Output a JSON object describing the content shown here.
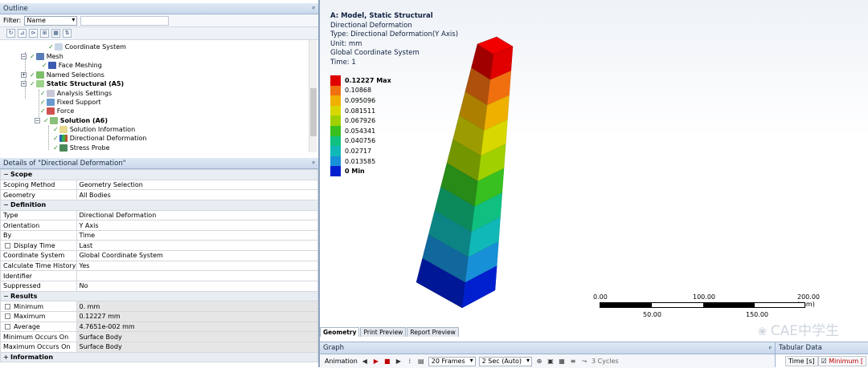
{
  "outline": {
    "title": "Outline",
    "pin": "ᵖ",
    "filter_label": "Filter:",
    "filter_value": "Name",
    "toolbar_icons": [
      "refresh-icon",
      "expand-icon",
      "flag-icon",
      "collapse-all-icon",
      "image-icon",
      "sort-icon"
    ],
    "tree": [
      {
        "label": "Coordinate System",
        "bold": false
      },
      {
        "label": "Mesh",
        "bold": false
      },
      {
        "label": "Face Meshing",
        "bold": false
      },
      {
        "label": "Named Selections",
        "bold": false
      },
      {
        "label": "Static Structural (A5)",
        "bold": true
      },
      {
        "label": "Analysis Settings",
        "bold": false
      },
      {
        "label": "Fixed Support",
        "bold": false
      },
      {
        "label": "Force",
        "bold": false
      },
      {
        "label": "Solution (A6)",
        "bold": true
      },
      {
        "label": "Solution Information",
        "bold": false
      },
      {
        "label": "Directional Deformation",
        "bold": false
      },
      {
        "label": "Stress Probe",
        "bold": false
      }
    ]
  },
  "details": {
    "title": "Details of \"Directional Deformation\"",
    "sections": [
      {
        "name": "Scope",
        "rows": [
          {
            "k": "Scoping Method",
            "v": "Geometry Selection"
          },
          {
            "k": "Geometry",
            "v": "All Bodies"
          }
        ]
      },
      {
        "name": "Definition",
        "rows": [
          {
            "k": "Type",
            "v": "Directional Deformation"
          },
          {
            "k": "Orientation",
            "v": "Y Axis"
          },
          {
            "k": "By",
            "v": "Time"
          },
          {
            "k": "Display Time",
            "v": "Last"
          },
          {
            "k": "Coordinate System",
            "v": "Global Coordinate System"
          },
          {
            "k": "Calculate Time History",
            "v": "Yes"
          },
          {
            "k": "Identifier",
            "v": ""
          },
          {
            "k": "Suppressed",
            "v": "No"
          }
        ]
      },
      {
        "name": "Results",
        "rows": [
          {
            "k": "Minimum",
            "v": "0. mm"
          },
          {
            "k": "Maximum",
            "v": "0.12227 mm"
          },
          {
            "k": "Average",
            "v": "4.7651e-002 mm"
          },
          {
            "k": "Minimum Occurs On",
            "v": "Surface Body"
          },
          {
            "k": "Maximum Occurs On",
            "v": "Surface Body"
          }
        ]
      },
      {
        "name": "Information",
        "rows": []
      }
    ]
  },
  "viewport": {
    "info": {
      "title": "A: Model, Static Structural",
      "line1": "Directional Deformation",
      "line2": "Type: Directional Deformation(Y Axis)",
      "line3": "Unit: mm",
      "line4": "Global Coordinate System",
      "line5": "Time: 1"
    },
    "legend": [
      {
        "label": "0.12227 Max",
        "color": "#e00000",
        "bold": true
      },
      {
        "label": "0.10868",
        "color": "#f07010",
        "bold": false
      },
      {
        "label": "0.095096",
        "color": "#f0b000",
        "bold": false
      },
      {
        "label": "0.081511",
        "color": "#d8d800",
        "bold": false
      },
      {
        "label": "0.067926",
        "color": "#a0d000",
        "bold": false
      },
      {
        "label": "0.054341",
        "color": "#38c020",
        "bold": false
      },
      {
        "label": "0.040756",
        "color": "#10c080",
        "bold": false
      },
      {
        "label": "0.02717",
        "color": "#10b8b8",
        "bold": false
      },
      {
        "label": "0.013585",
        "color": "#1890d8",
        "bold": false
      },
      {
        "label": "0 Min",
        "color": "#0020d0",
        "bold": true
      }
    ],
    "scale": {
      "t0": "0.00",
      "t100": "100.00",
      "t200": "200.00 (mm)",
      "t50": "50.00",
      "t150": "150.00"
    },
    "tabs": [
      "Geometry",
      "Print Preview",
      "Report Preview"
    ],
    "watermark": "CAE中学生"
  },
  "graph": {
    "title": "Graph",
    "animation_label": "Animation",
    "frames": "20 Frames",
    "duration": "2 Sec (Auto)",
    "cycles": "3 Cycles"
  },
  "tabular": {
    "title": "Tabular Data",
    "col_time": "Time [s]",
    "col_min": "Minimum ["
  }
}
